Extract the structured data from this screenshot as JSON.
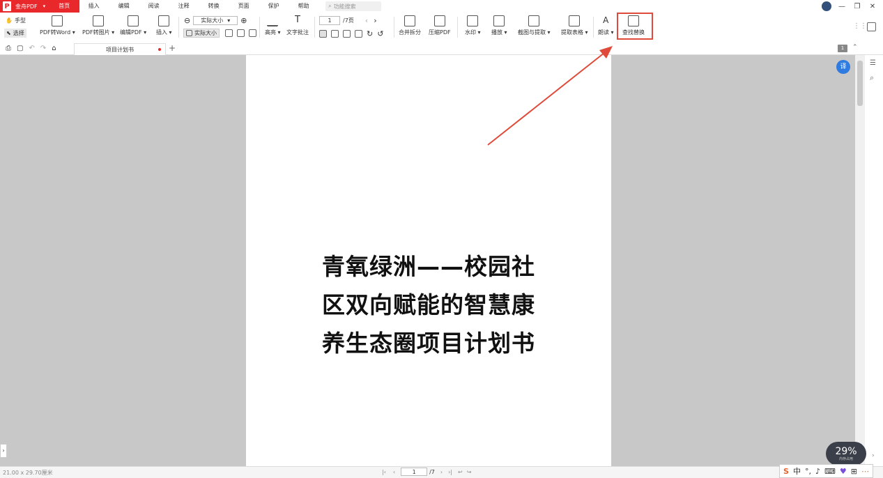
{
  "app": {
    "name": "金舟PDF",
    "logo_letter": "P"
  },
  "menu": [
    "首页",
    "插入",
    "编辑",
    "阅读",
    "注释",
    "转换",
    "页面",
    "保护",
    "帮助"
  ],
  "active_menu": "首页",
  "search": {
    "placeholder": "功能搜索"
  },
  "toolbar": {
    "hand": "手型",
    "select": "选择",
    "pdf_to_word": "PDF转Word",
    "pdf_to_image": "PDF转图片",
    "edit_pdf": "编辑PDF",
    "insert": "插入",
    "zoom_value": "实际大小",
    "actual_size": "实际大小",
    "highlight": "高亮",
    "text_note": "文字批注",
    "page_current": "1",
    "page_total": "/7页",
    "merge_split": "合并拆分",
    "compress": "压缩PDF",
    "watermark": "水印",
    "play": "播放",
    "capture_extract": "截图与提取",
    "extract_table": "提取表格",
    "read_aloud": "朗读",
    "find_replace": "查找替换"
  },
  "tab": {
    "title": "项目计划书"
  },
  "page_badge": "1",
  "document": {
    "lines": [
      "青氧绿洲——校园社",
      "区双向赋能的智慧康",
      "养生态圈项目计划书"
    ]
  },
  "status": {
    "page_size": "21.00 x 29.70厘米",
    "page_current": "1",
    "page_total": "/7"
  },
  "widget": {
    "percent": "29%",
    "label": "内存占用"
  },
  "ime": {
    "lang": "中"
  },
  "colors": {
    "brand": "#e8282b",
    "annotation": "#e04a3a"
  }
}
